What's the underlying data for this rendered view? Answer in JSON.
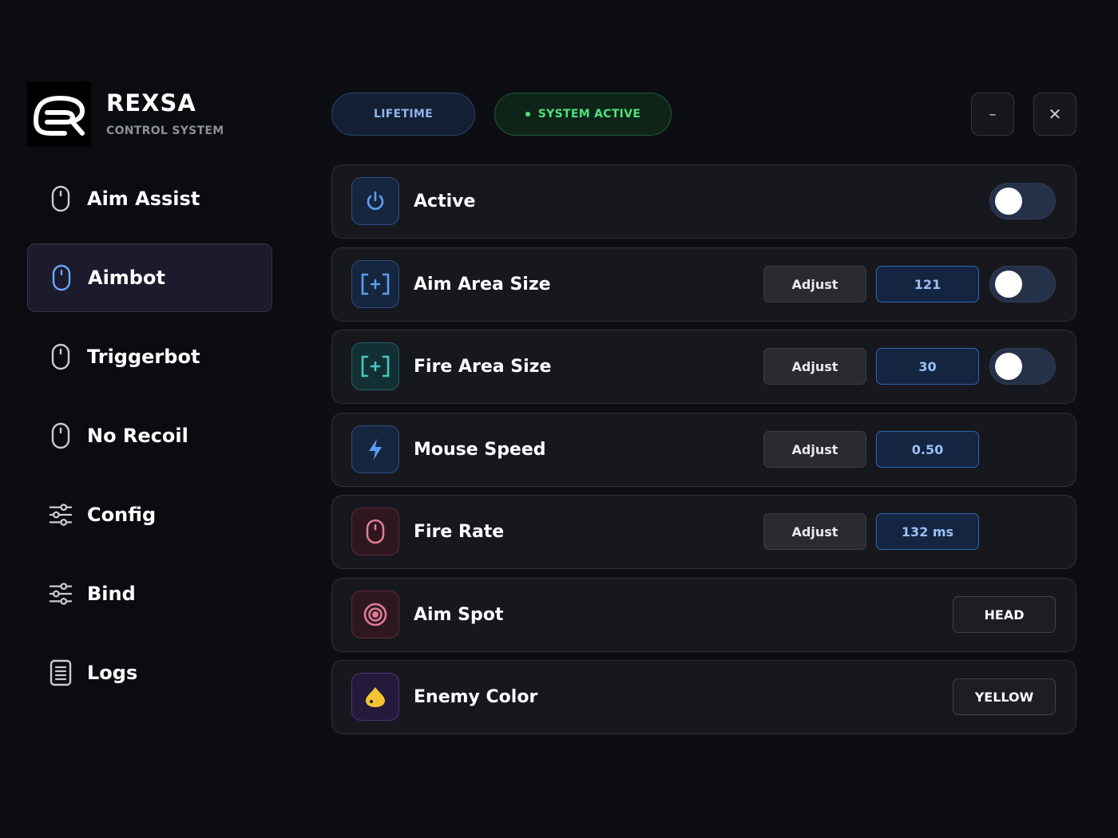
{
  "brand": {
    "name": "REXSA",
    "subtitle": "CONTROL SYSTEM"
  },
  "sidebar": {
    "items": [
      {
        "label": "Aim Assist",
        "icon": "mouse-icon",
        "active": false
      },
      {
        "label": "Aimbot",
        "icon": "mouse-icon",
        "active": true
      },
      {
        "label": "Triggerbot",
        "icon": "mouse-icon",
        "active": false
      },
      {
        "label": "No Recoil",
        "icon": "mouse-icon",
        "active": false
      },
      {
        "label": "Config",
        "icon": "sliders-icon",
        "active": false
      },
      {
        "label": "Bind",
        "icon": "sliders-icon",
        "active": false
      },
      {
        "label": "Logs",
        "icon": "document-icon",
        "active": false
      }
    ]
  },
  "header": {
    "license_label": "LIFETIME",
    "status_label": "SYSTEM ACTIVE",
    "minimize_glyph": "–",
    "close_glyph": "✕"
  },
  "settings": {
    "active": {
      "label": "Active",
      "icon": "power-icon",
      "toggle_on": false
    },
    "aim_area": {
      "label": "Aim Area Size",
      "icon": "crosshair-bracket-icon",
      "adjust_label": "Adjust",
      "value": "121",
      "toggle_on": false
    },
    "fire_area": {
      "label": "Fire Area Size",
      "icon": "crosshair-bracket-icon",
      "adjust_label": "Adjust",
      "value": "30",
      "toggle_on": false
    },
    "mouse_speed": {
      "label": "Mouse Speed",
      "icon": "lightning-icon",
      "adjust_label": "Adjust",
      "value": "0.50"
    },
    "fire_rate": {
      "label": "Fire Rate",
      "icon": "mouse-icon",
      "adjust_label": "Adjust",
      "value": "132 ms"
    },
    "aim_spot": {
      "label": "Aim Spot",
      "icon": "target-icon",
      "selected": "HEAD"
    },
    "enemy_color": {
      "label": "Enemy Color",
      "icon": "droplet-icon",
      "selected": "YELLOW"
    }
  },
  "colors": {
    "background": "#0d0e13",
    "sidebar": "#0b0c10",
    "card": "#17181e",
    "accent_blue": "#3a7ee0",
    "status_green": "#4ee07f",
    "fire_red": "#e07a95",
    "enemy_yellow": "#f4c330"
  }
}
